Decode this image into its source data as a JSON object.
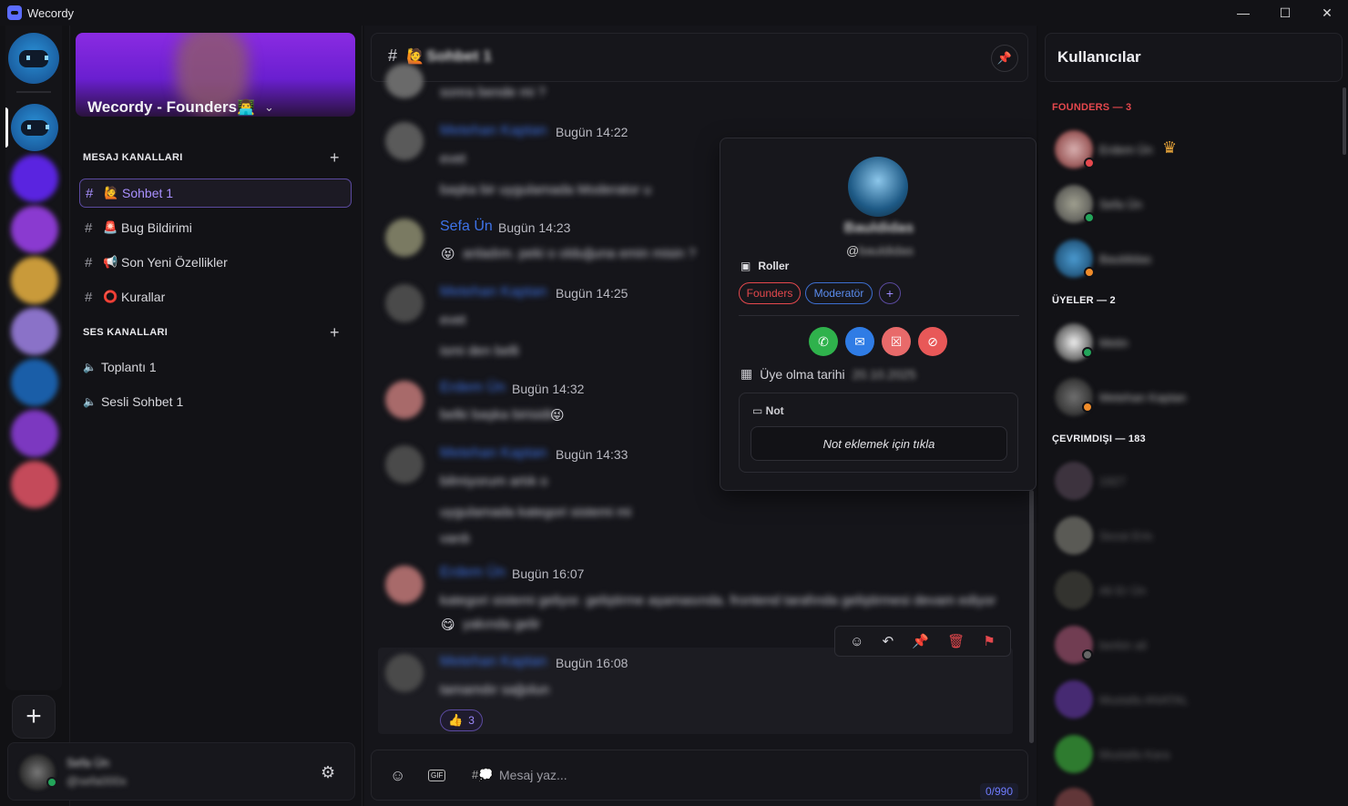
{
  "window": {
    "title": "Wecordy",
    "controls": {
      "minimize": "—",
      "maximize": "☐",
      "close": "✕"
    }
  },
  "server": {
    "name": "Wecordy - Founders",
    "name_emoji": "👨‍💻",
    "chevron": "⌄"
  },
  "sections": {
    "text": "MESAJ KANALLARI",
    "voice": "SES KANALLARI",
    "add": "+"
  },
  "channels": [
    {
      "emoji": "🙋",
      "label": "Sohbet 1",
      "active": true
    },
    {
      "emoji": "🚨",
      "label": "Bug Bildirimi"
    },
    {
      "emoji": "📢",
      "label": "Son Yeni Özellikler"
    },
    {
      "emoji": "⭕",
      "label": "Kurallar"
    }
  ],
  "hash": "#",
  "voice_channels": [
    {
      "label": "Toplantı 1"
    },
    {
      "label": "Sesli Sohbet 1"
    }
  ],
  "me": {
    "name": "Sefa Ün",
    "handle": "@sefa000x"
  },
  "chat": {
    "channel_emoji": "🙋",
    "channel_title": "Sohbet 1",
    "messages": [
      {
        "lines": [
          "sonra bende mi ?"
        ]
      },
      {
        "author": "Metehan Kaptan",
        "time": "Bugün 14:22",
        "lines": [
          "evet",
          "başka bir uygulamada Moderator u"
        ]
      },
      {
        "author": "Sefa Ün",
        "time": "Bugün 14:23",
        "emoji": "😝",
        "lines": [
          "anladım. peki o olduğuna emin misin ?"
        ]
      },
      {
        "author": "Metehan Kaptan",
        "time": "Bugün 14:25",
        "lines": [
          "evet",
          "ismi den belli"
        ]
      },
      {
        "author": "Erdem Ün",
        "time": "Bugün 14:32",
        "emoji": "😜",
        "lines": [
          "belki başka birisidir"
        ]
      },
      {
        "author": "Metehan Kaptan",
        "time": "Bugün 14:33",
        "lines": [
          "bilmiyorum artık o",
          "uygulamada kategori sistemi mi",
          "vardı"
        ]
      },
      {
        "author": "Erdem Ün",
        "time": "Bugün 16:07",
        "emoji": "😋",
        "lines": [
          "kategori sistemi geliyor. geliştirme aşamasında. frontend tarafında geliştirmesi devam ediyor",
          "yakında gelir"
        ]
      },
      {
        "author": "Metehan Kaptan",
        "time": "Bugün 16:08",
        "lines": [
          "tamamdır sağolun"
        ],
        "reaction": {
          "emoji": "👍",
          "count": "3"
        }
      }
    ],
    "toolbar": {
      "react": "☺",
      "reply": "↶",
      "pin": "📌",
      "delete": "🗑",
      "report": "⚑"
    },
    "pin_icon": "📌",
    "composer": {
      "placeholder": "Mesaj yaz...",
      "hash": "#💭",
      "emoji_btn": "☺",
      "gif_btn": "GIF",
      "counter": "0/990"
    }
  },
  "profile": {
    "name": "Bauldidas",
    "handle_prefix": "@",
    "handle": "bauldidas",
    "roles_title": "Roller",
    "roles": [
      {
        "label": "Founders",
        "color": "#e5484d"
      },
      {
        "label": "Moderatör",
        "color": "#5b8def"
      }
    ],
    "role_add": "+",
    "member_since_label": "Üye olma tarihi",
    "member_since_value": "20.10.2025",
    "note_title": "Not",
    "note_placeholder": "Not eklemek için tıkla",
    "actions": {
      "call": "✆",
      "message": "✉",
      "remove": "☒",
      "block": "⊘"
    }
  },
  "members": {
    "title": "Kullanıcılar",
    "groups": [
      {
        "title": "FOUNDERS — 3",
        "color": "#e5484d",
        "items": [
          {
            "name": "Erdem Ün",
            "crown": "♛"
          },
          {
            "name": "Sefa Ün"
          },
          {
            "name": "Bauldidas"
          }
        ]
      },
      {
        "title": "ÜYELER — 2",
        "color": "#f0f0f4",
        "items": [
          {
            "name": "Metin"
          },
          {
            "name": "Metehan Kaptan"
          }
        ]
      },
      {
        "title": "ÇEVRIMDIŞI — 183",
        "color": "#f0f0f4",
        "items": [
          {
            "name": "1927"
          },
          {
            "name": "Sezai Eris"
          },
          {
            "name": "Ali Er Ün"
          },
          {
            "name": "berkin ali"
          },
          {
            "name": "Mustafa ANATAL"
          },
          {
            "name": "Mustafa Kara"
          }
        ]
      }
    ]
  },
  "rail": {
    "add": "+"
  },
  "settings_icon": "⚙"
}
